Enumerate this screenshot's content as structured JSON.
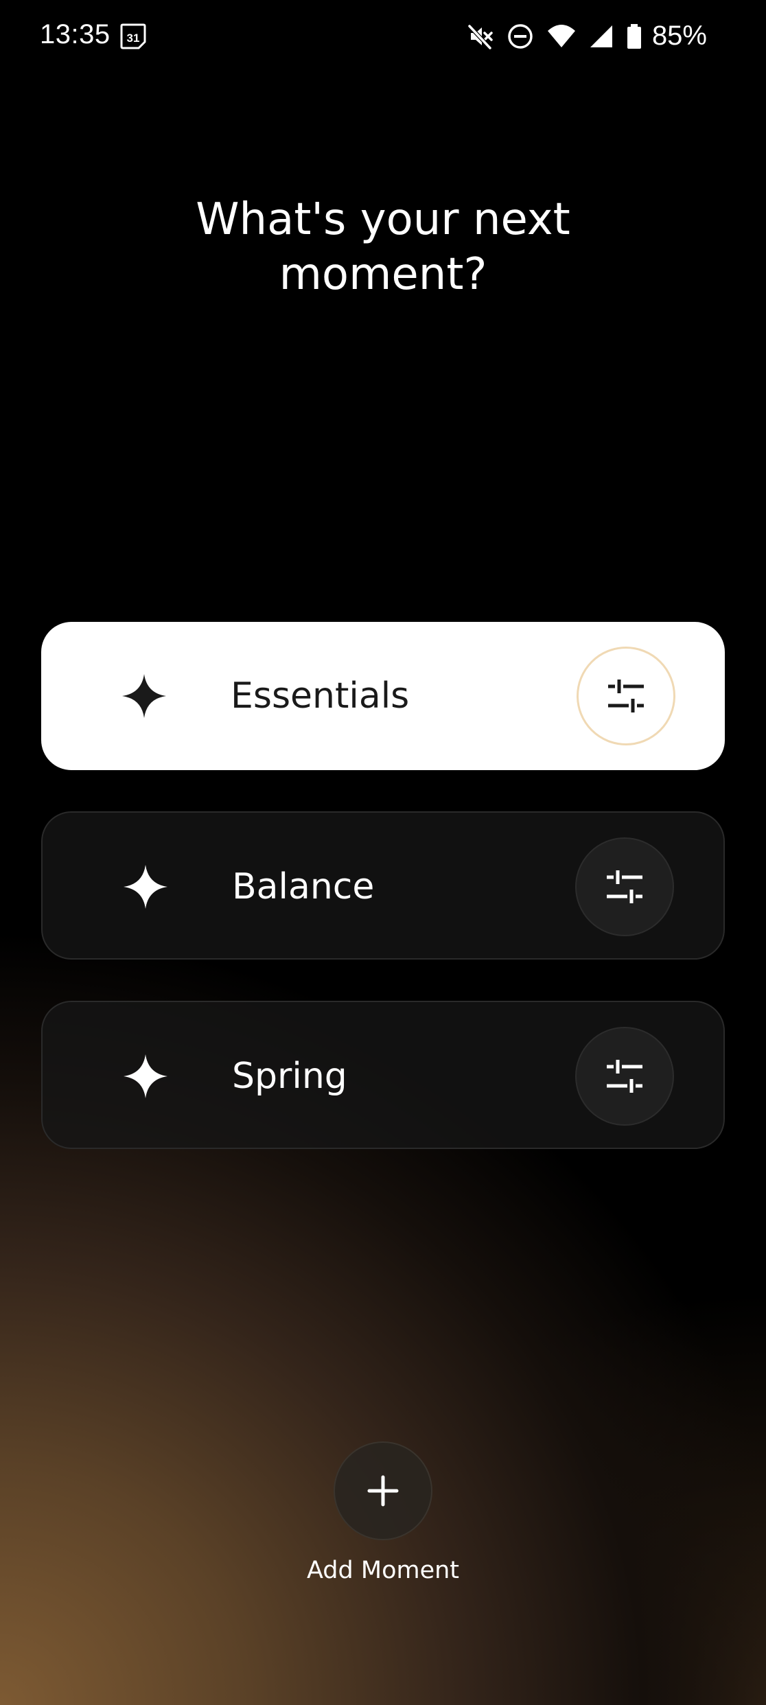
{
  "status_bar": {
    "time": "13:35",
    "calendar_day": "31",
    "battery": "85%",
    "icons": [
      "calendar-icon",
      "mute-icon",
      "do-not-disturb-icon",
      "wifi-icon",
      "cell-signal-icon",
      "battery-icon"
    ]
  },
  "title": "What's your next\nmoment?",
  "moments": [
    {
      "label": "Essentials",
      "selected": true,
      "icon": "sparkle-icon",
      "action_icon": "tune-icon"
    },
    {
      "label": "Balance",
      "selected": false,
      "icon": "sparkle-icon",
      "action_icon": "tune-icon"
    },
    {
      "label": "Spring",
      "selected": false,
      "icon": "sparkle-icon",
      "action_icon": "tune-icon"
    }
  ],
  "add_moment": {
    "label": "Add Moment",
    "icon": "plus-icon"
  },
  "colors": {
    "card_selected_bg": "#ffffff",
    "card_unselected_bg": "#161616",
    "accent_ring": "#f0d9b4",
    "gradient_warm": "#7d5a33"
  }
}
